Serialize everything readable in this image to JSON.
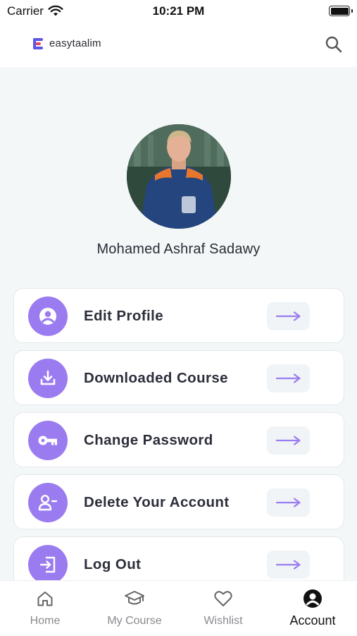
{
  "status_bar": {
    "carrier": "Carrier",
    "time": "10:21 PM"
  },
  "header": {
    "brand": "easytaalim"
  },
  "profile": {
    "name": "Mohamed Ashraf Sadawy"
  },
  "menu": [
    {
      "label": "Edit Profile",
      "icon": "user-circle-icon"
    },
    {
      "label": "Downloaded Course",
      "icon": "download-icon"
    },
    {
      "label": "Change Password",
      "icon": "key-icon"
    },
    {
      "label": "Delete Your Account",
      "icon": "user-minus-icon"
    },
    {
      "label": "Log Out",
      "icon": "logout-icon"
    }
  ],
  "tabs": [
    {
      "label": "Home",
      "icon": "home-icon",
      "active": false
    },
    {
      "label": "My Course",
      "icon": "graduation-cap-icon",
      "active": false
    },
    {
      "label": "Wishlist",
      "icon": "heart-icon",
      "active": false
    },
    {
      "label": "Account",
      "icon": "account-icon",
      "active": true
    }
  ],
  "colors": {
    "accent": "#9b7cf0",
    "background": "#f4f7f8",
    "card": "#ffffff",
    "arrow_bg": "#f1f4f6"
  }
}
